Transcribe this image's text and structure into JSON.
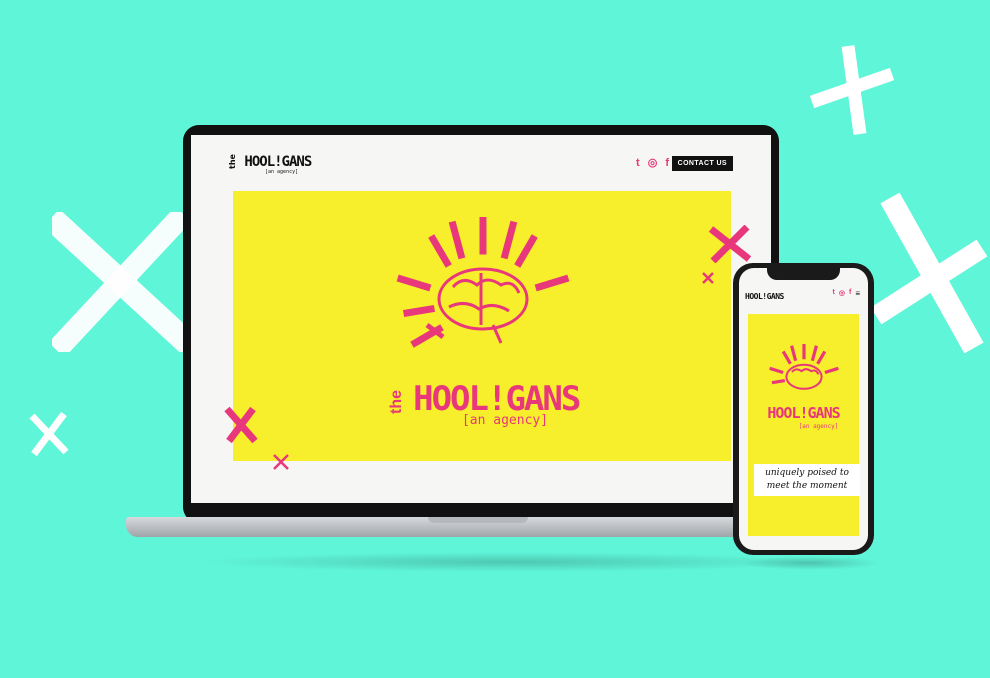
{
  "brand": {
    "the": "the",
    "name": "HOOL!GANS",
    "sub": "[an agency]"
  },
  "desktop": {
    "nav": {
      "icons": [
        "twitter-icon",
        "instagram-icon",
        "facebook-icon"
      ],
      "twitter": "t",
      "instagram": "◎",
      "facebook": "f",
      "contact_label": "CONTACT US"
    }
  },
  "mobile": {
    "twitter": "t",
    "instagram": "◎",
    "facebook": "f",
    "menu": "≡",
    "tagline": "uniquely poised to meet the moment"
  },
  "colors": {
    "background": "#5ff5d8",
    "hero_yellow": "#f7ef2b",
    "accent_pink": "#e8387b",
    "ink": "#111111"
  }
}
